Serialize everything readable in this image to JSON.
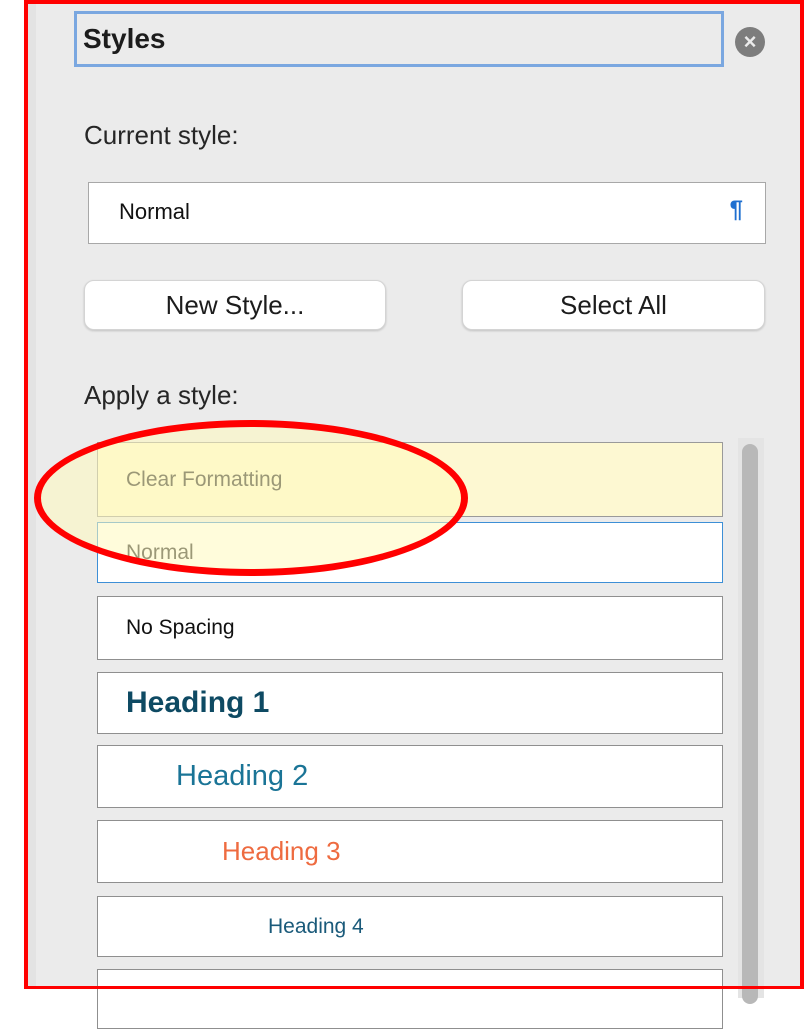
{
  "panel": {
    "title": "Styles",
    "close_icon": "close-circle-icon",
    "current_style_label": "Current style:",
    "current_style_value": "Normal",
    "pilcrow": "¶",
    "new_style_button": "New Style...",
    "select_all_button": "Select All",
    "apply_label": "Apply a style:"
  },
  "styles": [
    {
      "label": "Clear Formatting",
      "color": "#222222"
    },
    {
      "label": "Normal",
      "color": "#222222"
    },
    {
      "label": "No Spacing",
      "color": "#111111"
    },
    {
      "label": "Heading 1",
      "color": "#0e4a63"
    },
    {
      "label": "Heading 2",
      "color": "#1a7496"
    },
    {
      "label": "Heading 3",
      "color": "#ee6b40"
    },
    {
      "label": "Heading 4",
      "color": "#1a5a7a"
    },
    {
      "label": "",
      "color": "#222222"
    }
  ],
  "annotation": {
    "shape": "ellipse",
    "color": "#ff0000"
  }
}
